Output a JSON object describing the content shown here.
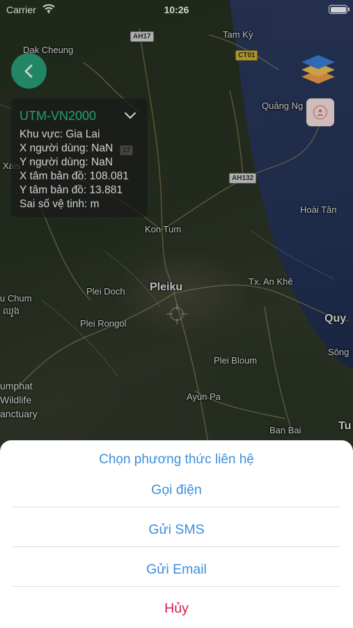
{
  "status_bar": {
    "carrier": "Carrier",
    "time": "10:26"
  },
  "map": {
    "labels": {
      "dak_cheung": "Dak Cheung",
      "tam_ky": "Tam Kỳ",
      "quang_ngai": "Quảng Ng",
      "xais": "Xais",
      "kon_tum": "Kon Tum",
      "hoai_tan": "Hoài Tân",
      "plei_doch": "Plei Doch",
      "pleiku": "Pleiku",
      "tx_an_khe": "Tx. An Khê",
      "u_chum": "u Chum",
      "u_chum_khmer": "ឈូង",
      "quy": "Quy",
      "plei_rongol": "Plei Rongol",
      "song": "Sông",
      "plei_bloum": "Plei Bloum",
      "umphat": "umphat",
      "wildlife": "Wildlife",
      "sanctuary": "anctuary",
      "ayun_pa": "Ayun Pa",
      "ban_bai": "Ban Bai",
      "tu": "Tu"
    },
    "shields": {
      "ah17": "AH17",
      "ct01": "CT01",
      "ah132": "AH132",
      "s17": "17"
    }
  },
  "info_panel": {
    "coordinate_system": "UTM-VN2000",
    "lines": [
      "Khu vực: Gia Lai",
      "X người dùng: NaN",
      "Y người dùng: NaN",
      "X tâm bản đồ: 108.081",
      "Y tâm bản đồ: 13.881",
      "Sai số vệ tinh:  m"
    ]
  },
  "action_sheet": {
    "title": "Chọn phương thức liên hệ",
    "options": [
      "Gọi điện",
      "Gửi SMS",
      "Gửi Email"
    ],
    "cancel": "Hủy"
  },
  "colors": {
    "accent_green": "#2aa37a",
    "system_text": "#2fc192",
    "action_blue": "#3b8fdc",
    "cancel_red": "#d81b4a"
  },
  "icons": {
    "back": "chevron-left-icon",
    "layers": "layers-icon",
    "contact": "contact-person-icon",
    "dropdown": "chevron-down-icon",
    "crosshair": "crosshair-icon",
    "wifi": "wifi-icon",
    "battery": "battery-icon"
  }
}
